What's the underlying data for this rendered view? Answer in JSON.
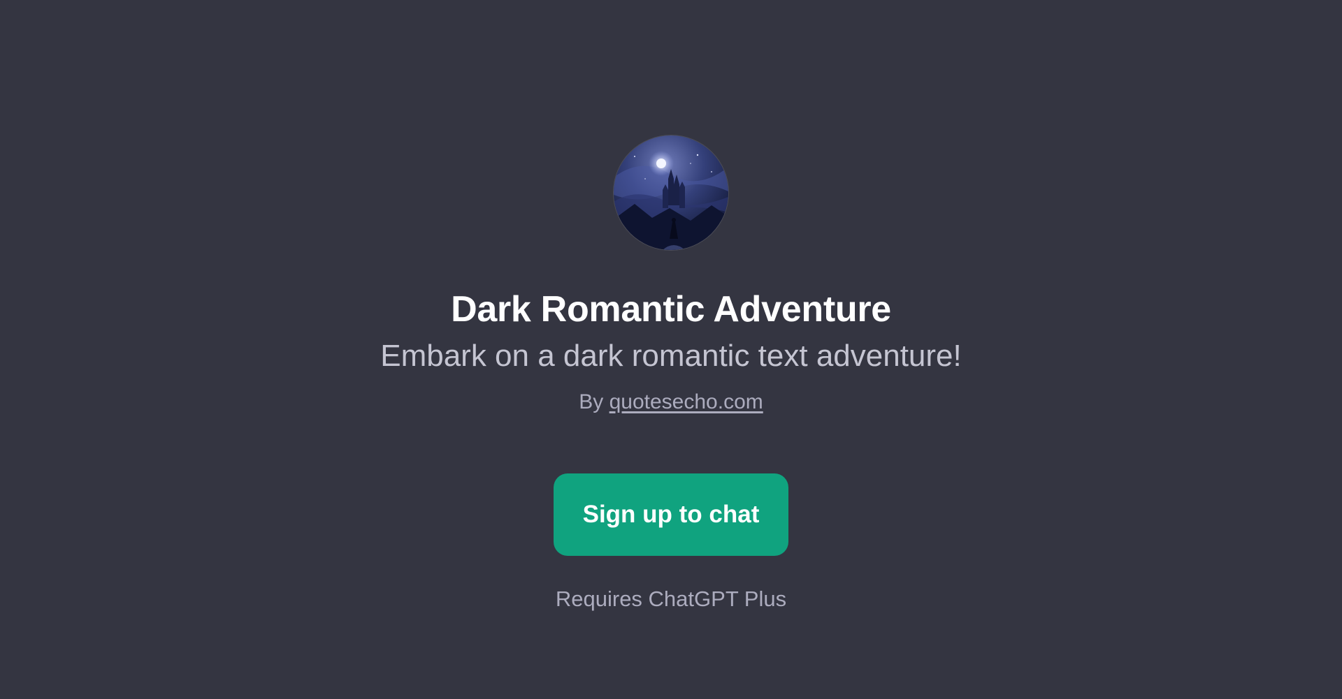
{
  "gpt": {
    "avatar_icon": "dark-castle-moon-avatar",
    "title": "Dark Romantic Adventure",
    "description": "Embark on a dark romantic text adventure!",
    "by_prefix": "By",
    "author_link": "quotesecho.com"
  },
  "actions": {
    "signup_label": "Sign up to chat",
    "requirement_note": "Requires ChatGPT Plus"
  },
  "colors": {
    "background": "#343541",
    "accent": "#10a37f",
    "title": "#ffffff",
    "muted": "#acacbe"
  }
}
